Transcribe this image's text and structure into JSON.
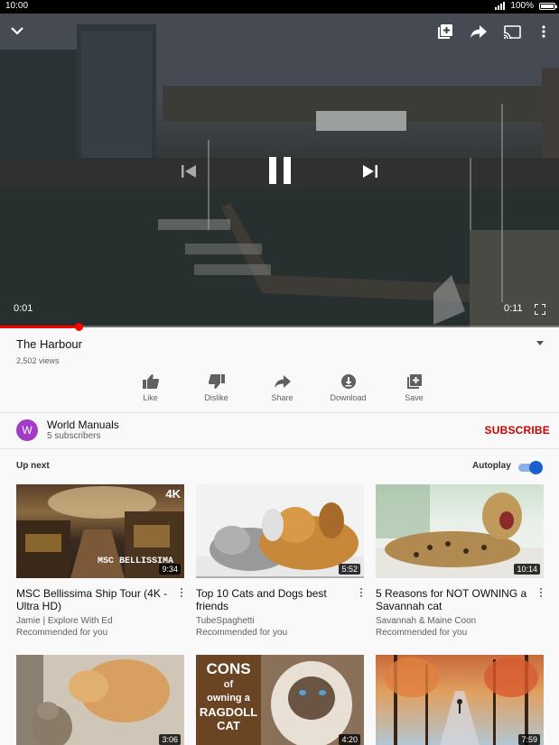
{
  "status_bar": {
    "time": "10:00",
    "battery": "100%"
  },
  "player": {
    "current_time": "0:01",
    "duration": "0:11",
    "progress_fraction": 0.14,
    "icons": [
      "chevron-down-icon",
      "add-to-queue-icon",
      "share-icon",
      "cast-icon",
      "more-vert-icon",
      "previous-icon",
      "pause-icon",
      "next-icon",
      "fullscreen-icon"
    ]
  },
  "video": {
    "title": "The Harbour",
    "views": "2,502 views"
  },
  "actions": [
    {
      "label": "Like",
      "icon": "thumb-up-icon"
    },
    {
      "label": "Dislike",
      "icon": "thumb-down-icon"
    },
    {
      "label": "Share",
      "icon": "share-icon"
    },
    {
      "label": "Download",
      "icon": "download-icon"
    },
    {
      "label": "Save",
      "icon": "save-icon"
    }
  ],
  "channel": {
    "initial": "W",
    "name": "World Manuals",
    "subscribers": "5 subscribers",
    "subscribe_label": "SUBSCRIBE",
    "avatar_color": "#a23cc7"
  },
  "up_next": {
    "heading": "Up next",
    "autoplay_label": "Autoplay",
    "autoplay_on": true
  },
  "recommendations": [
    {
      "title": "MSC Bellissima Ship Tour (4K - Ultra HD)",
      "channel": "Jamie | Explore With Ed",
      "reason": "Recommended for you",
      "duration": "9:34",
      "badge": "4K",
      "overlay": "MSC BELLISSIMA"
    },
    {
      "title": "Top 10 Cats and Dogs best friends",
      "channel": "TubeSpaghetti",
      "reason": "Recommended for you",
      "duration": "5:52"
    },
    {
      "title": "5 Reasons for NOT OWNING a Savannah cat",
      "channel": "Savannah & Maine Coon",
      "reason": "Recommended for you",
      "duration": "10:14"
    },
    {
      "duration": "3:06"
    },
    {
      "duration": "4:20",
      "overlay_lines": [
        "CONS",
        "of",
        "owning a",
        "RAGDOLL",
        "CAT"
      ]
    },
    {
      "duration": "7:59"
    }
  ],
  "colors": {
    "accent_red": "#ff0000",
    "subscribe_red": "#cc0000",
    "toggle_blue": "#1a5fcf"
  }
}
